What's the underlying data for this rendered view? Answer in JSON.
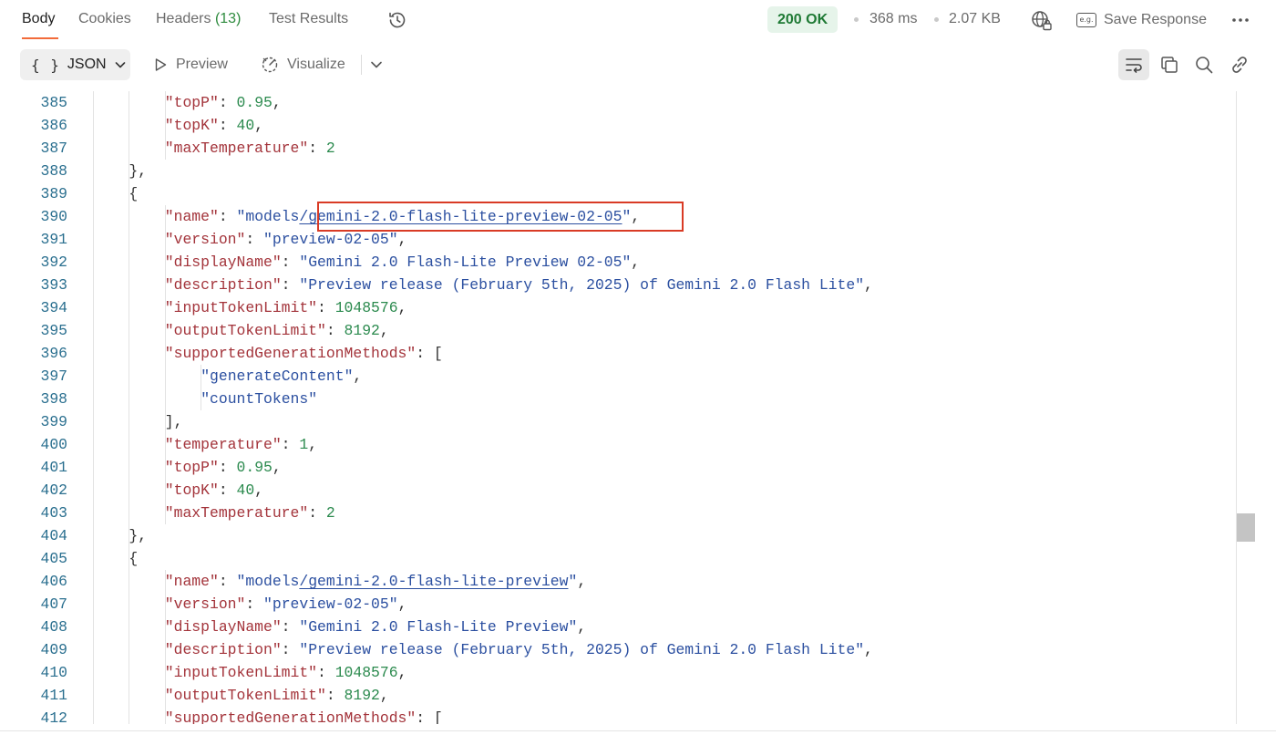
{
  "tabs": {
    "body": "Body",
    "cookies": "Cookies",
    "headers_label": "Headers",
    "headers_count": "(13)",
    "test_results": "Test Results"
  },
  "response": {
    "status": "200 OK",
    "time": "368 ms",
    "size": "2.07 KB",
    "save_label": "Save Response",
    "save_icon_text": "e.g."
  },
  "toolbar": {
    "format": "JSON",
    "format_icon_text": "{ }",
    "preview": "Preview",
    "visualize": "Visualize"
  },
  "icons": {
    "history": "history-icon",
    "globe_lock": "globe-lock-icon",
    "more": "more-horizontal-icon",
    "play": "play-icon",
    "visualize": "visualize-icon",
    "chevron": "chevron-down-icon",
    "wrap": "wrap-lines-icon",
    "copy": "copy-icon",
    "search": "search-icon",
    "link": "link-icon"
  },
  "colors": {
    "accent": "#f26b3a",
    "status_bg": "#e6f4ea",
    "status_text": "#1f7a35",
    "key": "#a3333a",
    "string": "#2b4fa0",
    "number": "#2b8a4e",
    "line_number": "#2a6f8f",
    "highlight": "#d93b25"
  },
  "lines": [
    {
      "n": "385",
      "t": [
        [
          "k",
          "\"topP\""
        ],
        [
          "p",
          ": "
        ],
        [
          "n",
          "0.95"
        ],
        [
          "p",
          ","
        ]
      ]
    },
    {
      "n": "386",
      "t": [
        [
          "k",
          "\"topK\""
        ],
        [
          "p",
          ": "
        ],
        [
          "n",
          "40"
        ],
        [
          "p",
          ","
        ]
      ]
    },
    {
      "n": "387",
      "t": [
        [
          "k",
          "\"maxTemperature\""
        ],
        [
          "p",
          ": "
        ],
        [
          "n",
          "2"
        ]
      ]
    },
    {
      "n": "388",
      "t": [
        [
          "p",
          "},"
        ]
      ]
    },
    {
      "n": "389",
      "t": [
        [
          "p",
          "{"
        ]
      ]
    },
    {
      "n": "390",
      "t": [
        [
          "k",
          "\"name\""
        ],
        [
          "p",
          ": "
        ],
        [
          "s",
          "\"models"
        ],
        [
          "su",
          "/gemini-2.0-flash-lite-preview-02-05"
        ],
        [
          "s",
          "\""
        ],
        [
          "p",
          ","
        ]
      ]
    },
    {
      "n": "391",
      "t": [
        [
          "k",
          "\"version\""
        ],
        [
          "p",
          ": "
        ],
        [
          "s",
          "\"preview-02-05\""
        ],
        [
          "p",
          ","
        ]
      ]
    },
    {
      "n": "392",
      "t": [
        [
          "k",
          "\"displayName\""
        ],
        [
          "p",
          ": "
        ],
        [
          "s",
          "\"Gemini 2.0 Flash-Lite Preview 02-05\""
        ],
        [
          "p",
          ","
        ]
      ]
    },
    {
      "n": "393",
      "t": [
        [
          "k",
          "\"description\""
        ],
        [
          "p",
          ": "
        ],
        [
          "s",
          "\"Preview release (February 5th, 2025) of Gemini 2.0 Flash Lite\""
        ],
        [
          "p",
          ","
        ]
      ]
    },
    {
      "n": "394",
      "t": [
        [
          "k",
          "\"inputTokenLimit\""
        ],
        [
          "p",
          ": "
        ],
        [
          "n",
          "1048576"
        ],
        [
          "p",
          ","
        ]
      ]
    },
    {
      "n": "395",
      "t": [
        [
          "k",
          "\"outputTokenLimit\""
        ],
        [
          "p",
          ": "
        ],
        [
          "n",
          "8192"
        ],
        [
          "p",
          ","
        ]
      ]
    },
    {
      "n": "396",
      "t": [
        [
          "k",
          "\"supportedGenerationMethods\""
        ],
        [
          "p",
          ": ["
        ]
      ]
    },
    {
      "n": "397",
      "t": [
        [
          "s",
          "\"generateContent\""
        ],
        [
          "p",
          ","
        ]
      ]
    },
    {
      "n": "398",
      "t": [
        [
          "s",
          "\"countTokens\""
        ]
      ]
    },
    {
      "n": "399",
      "t": [
        [
          "p",
          "],"
        ]
      ]
    },
    {
      "n": "400",
      "t": [
        [
          "k",
          "\"temperature\""
        ],
        [
          "p",
          ": "
        ],
        [
          "n",
          "1"
        ],
        [
          "p",
          ","
        ]
      ]
    },
    {
      "n": "401",
      "t": [
        [
          "k",
          "\"topP\""
        ],
        [
          "p",
          ": "
        ],
        [
          "n",
          "0.95"
        ],
        [
          "p",
          ","
        ]
      ]
    },
    {
      "n": "402",
      "t": [
        [
          "k",
          "\"topK\""
        ],
        [
          "p",
          ": "
        ],
        [
          "n",
          "40"
        ],
        [
          "p",
          ","
        ]
      ]
    },
    {
      "n": "403",
      "t": [
        [
          "k",
          "\"maxTemperature\""
        ],
        [
          "p",
          ": "
        ],
        [
          "n",
          "2"
        ]
      ]
    },
    {
      "n": "404",
      "t": [
        [
          "p",
          "},"
        ]
      ]
    },
    {
      "n": "405",
      "t": [
        [
          "p",
          "{"
        ]
      ]
    },
    {
      "n": "406",
      "t": [
        [
          "k",
          "\"name\""
        ],
        [
          "p",
          ": "
        ],
        [
          "s",
          "\"models"
        ],
        [
          "su",
          "/gemini-2.0-flash-lite-preview"
        ],
        [
          "s",
          "\""
        ],
        [
          "p",
          ","
        ]
      ]
    },
    {
      "n": "407",
      "t": [
        [
          "k",
          "\"version\""
        ],
        [
          "p",
          ": "
        ],
        [
          "s",
          "\"preview-02-05\""
        ],
        [
          "p",
          ","
        ]
      ]
    },
    {
      "n": "408",
      "t": [
        [
          "k",
          "\"displayName\""
        ],
        [
          "p",
          ": "
        ],
        [
          "s",
          "\"Gemini 2.0 Flash-Lite Preview\""
        ],
        [
          "p",
          ","
        ]
      ]
    },
    {
      "n": "409",
      "t": [
        [
          "k",
          "\"description\""
        ],
        [
          "p",
          ": "
        ],
        [
          "s",
          "\"Preview release (February 5th, 2025) of Gemini 2.0 Flash Lite\""
        ],
        [
          "p",
          ","
        ]
      ]
    },
    {
      "n": "410",
      "t": [
        [
          "k",
          "\"inputTokenLimit\""
        ],
        [
          "p",
          ": "
        ],
        [
          "n",
          "1048576"
        ],
        [
          "p",
          ","
        ]
      ]
    },
    {
      "n": "411",
      "t": [
        [
          "k",
          "\"outputTokenLimit\""
        ],
        [
          "p",
          ": "
        ],
        [
          "n",
          "8192"
        ],
        [
          "p",
          ","
        ]
      ]
    },
    {
      "n": "412",
      "t": [
        [
          "k",
          "\"supportedGenerationMethods\""
        ],
        [
          "p",
          ": ["
        ]
      ]
    }
  ]
}
